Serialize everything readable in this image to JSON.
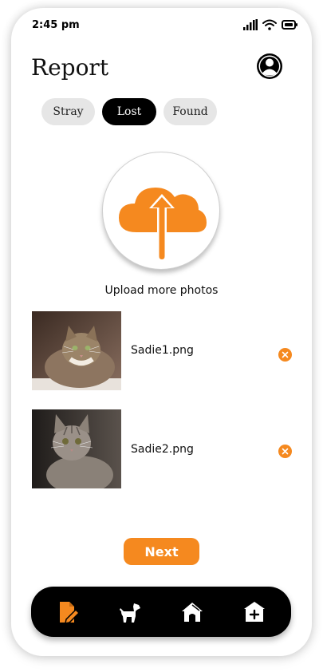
{
  "status_bar": {
    "time": "2:45 pm"
  },
  "header": {
    "title": "Report",
    "avatar_icon": "user-avatar-icon"
  },
  "filters": {
    "items": [
      {
        "label": "Stray",
        "active": false
      },
      {
        "label": "Lost",
        "active": true
      },
      {
        "label": "Found",
        "active": false
      }
    ]
  },
  "upload": {
    "icon": "cloud-upload-icon",
    "label": "Upload more photos"
  },
  "files": [
    {
      "name": "Sadie1.png"
    },
    {
      "name": "Sadie2.png"
    }
  ],
  "actions": {
    "next_label": "Next"
  },
  "bottom_nav": {
    "items": [
      {
        "icon": "report-edit-icon",
        "active": true
      },
      {
        "icon": "dog-icon",
        "active": false
      },
      {
        "icon": "home-icon",
        "active": false
      },
      {
        "icon": "add-shelter-icon",
        "active": false
      }
    ]
  },
  "colors": {
    "accent": "#f5891f",
    "dark": "#000000",
    "chip_inactive": "#e6e6e6"
  }
}
